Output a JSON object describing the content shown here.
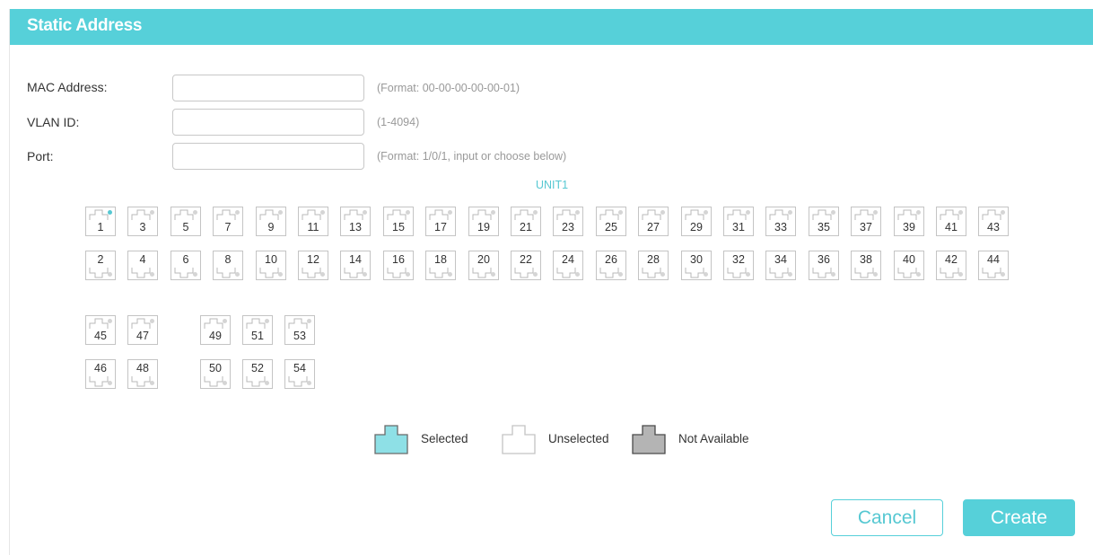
{
  "header": {
    "title": "Static Address"
  },
  "form": {
    "mac": {
      "label": "MAC Address:",
      "value": "",
      "hint": "(Format: 00-00-00-00-00-01)"
    },
    "vlan": {
      "label": "VLAN ID:",
      "value": "",
      "hint": "(1-4094)"
    },
    "port": {
      "label": "Port:",
      "value": "",
      "hint": "(Format: 1/0/1, input or choose below)"
    }
  },
  "unit": {
    "label": "UNIT1"
  },
  "ports": {
    "row1": [
      "1",
      "3",
      "5",
      "7",
      "9",
      "11",
      "13",
      "15",
      "17",
      "19",
      "21",
      "23",
      "25",
      "27",
      "29",
      "31",
      "33",
      "35",
      "37",
      "39",
      "41",
      "43"
    ],
    "row2": [
      "2",
      "4",
      "6",
      "8",
      "10",
      "12",
      "14",
      "16",
      "18",
      "20",
      "22",
      "24",
      "26",
      "28",
      "30",
      "32",
      "34",
      "36",
      "38",
      "40",
      "42",
      "44"
    ],
    "row3": [
      "45",
      "47",
      "49",
      "51",
      "53"
    ],
    "row4": [
      "46",
      "48",
      "50",
      "52",
      "54"
    ],
    "active_port": "1"
  },
  "legend": {
    "selected": "Selected",
    "unselected": "Unselected",
    "not_available": "Not Available"
  },
  "buttons": {
    "cancel": "Cancel",
    "create": "Create"
  },
  "colors": {
    "accent": "#56d0d9",
    "selected_fill": "#8ee0e6",
    "not_available_fill": "#b4b4b4"
  }
}
